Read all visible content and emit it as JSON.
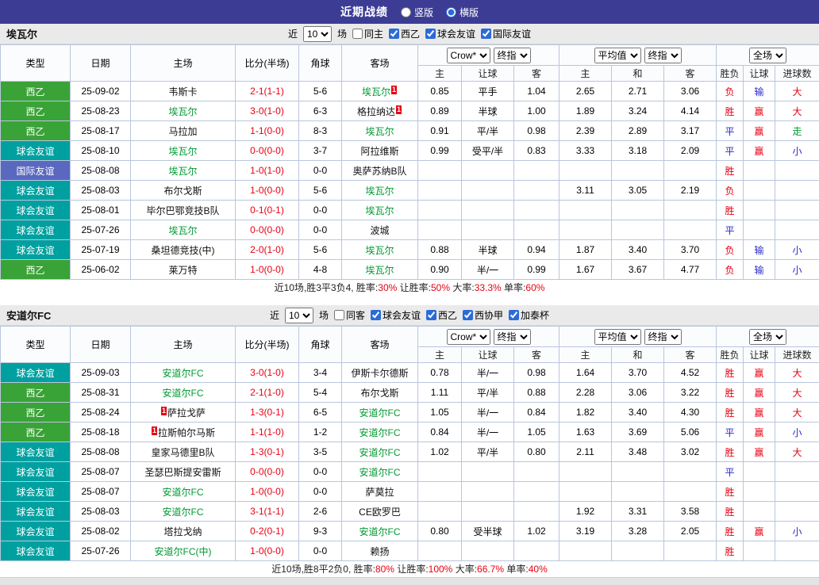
{
  "header": {
    "title": "近期战绩",
    "options": [
      {
        "label": "竖版",
        "selected": false
      },
      {
        "label": "横版",
        "selected": true
      }
    ]
  },
  "table_headers": {
    "main": [
      "类型",
      "日期",
      "主场",
      "比分(半场)",
      "角球",
      "客场"
    ],
    "ah_dropdowns": [
      "Crow*",
      "终指"
    ],
    "eu_dropdowns": [
      "平均值",
      "终指"
    ],
    "scope_dropdown": "全场",
    "sub": [
      "主",
      "让球",
      "客",
      "主",
      "和",
      "客",
      "胜负",
      "让球",
      "进球数"
    ]
  },
  "colors": {
    "red": "#e60012",
    "blue": "#2929cc",
    "green": "#009933",
    "black": "#222222",
    "type_green": "#3aa337",
    "type_teal": "#00a0a0",
    "type_blue": "#5a68c0"
  },
  "sections": [
    {
      "team": "埃瓦尔",
      "filter": {
        "near": "近",
        "count": "10",
        "games": "场",
        "checkboxes": [
          {
            "label": "同主",
            "checked": false
          },
          {
            "label": "西乙",
            "checked": true
          },
          {
            "label": "球会友谊",
            "checked": true
          },
          {
            "label": "国际友谊",
            "checked": true
          }
        ]
      },
      "rows": [
        {
          "type": "西乙",
          "type_color": "type_green",
          "date": "25-09-02",
          "home": "韦斯卡",
          "home_hl": false,
          "home_card": "",
          "score": "2-1(1-1)",
          "corner": "5-6",
          "away": "埃瓦尔",
          "away_hl": true,
          "away_card": "1",
          "ah": [
            "0.85",
            "平手",
            "1.04"
          ],
          "eu": [
            "2.65",
            "2.71",
            "3.06"
          ],
          "res": [
            {
              "t": "负",
              "c": "red"
            },
            {
              "t": "输",
              "c": "blue"
            },
            {
              "t": "大",
              "c": "red"
            }
          ]
        },
        {
          "type": "西乙",
          "type_color": "type_green",
          "date": "25-08-23",
          "home": "埃瓦尔",
          "home_hl": true,
          "home_card": "",
          "score": "3-0(1-0)",
          "corner": "6-3",
          "away": "格拉纳达",
          "away_hl": false,
          "away_card": "1",
          "ah": [
            "0.89",
            "半球",
            "1.00"
          ],
          "eu": [
            "1.89",
            "3.24",
            "4.14"
          ],
          "res": [
            {
              "t": "胜",
              "c": "red"
            },
            {
              "t": "赢",
              "c": "red"
            },
            {
              "t": "大",
              "c": "red"
            }
          ]
        },
        {
          "type": "西乙",
          "type_color": "type_green",
          "date": "25-08-17",
          "home": "马拉加",
          "home_hl": false,
          "home_card": "",
          "score": "1-1(0-0)",
          "corner": "8-3",
          "away": "埃瓦尔",
          "away_hl": true,
          "away_card": "",
          "ah": [
            "0.91",
            "平/半",
            "0.98"
          ],
          "eu": [
            "2.39",
            "2.89",
            "3.17"
          ],
          "res": [
            {
              "t": "平",
              "c": "blue"
            },
            {
              "t": "赢",
              "c": "red"
            },
            {
              "t": "走",
              "c": "green"
            }
          ]
        },
        {
          "type": "球会友谊",
          "type_color": "type_teal",
          "date": "25-08-10",
          "home": "埃瓦尔",
          "home_hl": true,
          "home_card": "",
          "score": "0-0(0-0)",
          "corner": "3-7",
          "away": "阿拉维斯",
          "away_hl": false,
          "away_card": "",
          "ah": [
            "0.99",
            "受平/半",
            "0.83"
          ],
          "eu": [
            "3.33",
            "3.18",
            "2.09"
          ],
          "res": [
            {
              "t": "平",
              "c": "blue"
            },
            {
              "t": "赢",
              "c": "red"
            },
            {
              "t": "小",
              "c": "blue"
            }
          ]
        },
        {
          "type": "国际友谊",
          "type_color": "type_blue",
          "date": "25-08-08",
          "home": "埃瓦尔",
          "home_hl": true,
          "home_card": "",
          "score": "1-0(1-0)",
          "corner": "0-0",
          "away": "奥萨苏纳B队",
          "away_hl": false,
          "away_card": "",
          "ah": [
            "",
            "",
            ""
          ],
          "eu": [
            "",
            "",
            ""
          ],
          "res": [
            {
              "t": "胜",
              "c": "red"
            },
            {
              "t": "",
              "c": "black"
            },
            {
              "t": "",
              "c": "black"
            }
          ]
        },
        {
          "type": "球会友谊",
          "type_color": "type_teal",
          "date": "25-08-03",
          "home": "布尔戈斯",
          "home_hl": false,
          "home_card": "",
          "score": "1-0(0-0)",
          "corner": "5-6",
          "away": "埃瓦尔",
          "away_hl": true,
          "away_card": "",
          "ah": [
            "",
            "",
            ""
          ],
          "eu": [
            "3.11",
            "3.05",
            "2.19"
          ],
          "res": [
            {
              "t": "负",
              "c": "red"
            },
            {
              "t": "",
              "c": "black"
            },
            {
              "t": "",
              "c": "black"
            }
          ]
        },
        {
          "type": "球会友谊",
          "type_color": "type_teal",
          "date": "25-08-01",
          "home": "毕尔巴鄂竞技B队",
          "home_hl": false,
          "home_card": "",
          "score": "0-1(0-1)",
          "corner": "0-0",
          "away": "埃瓦尔",
          "away_hl": true,
          "away_card": "",
          "ah": [
            "",
            "",
            ""
          ],
          "eu": [
            "",
            "",
            ""
          ],
          "res": [
            {
              "t": "胜",
              "c": "red"
            },
            {
              "t": "",
              "c": "black"
            },
            {
              "t": "",
              "c": "black"
            }
          ]
        },
        {
          "type": "球会友谊",
          "type_color": "type_teal",
          "date": "25-07-26",
          "home": "埃瓦尔",
          "home_hl": true,
          "home_card": "",
          "score": "0-0(0-0)",
          "corner": "0-0",
          "away": "波城",
          "away_hl": false,
          "away_card": "",
          "ah": [
            "",
            "",
            ""
          ],
          "eu": [
            "",
            "",
            ""
          ],
          "res": [
            {
              "t": "平",
              "c": "blue"
            },
            {
              "t": "",
              "c": "black"
            },
            {
              "t": "",
              "c": "black"
            }
          ]
        },
        {
          "type": "球会友谊",
          "type_color": "type_teal",
          "date": "25-07-19",
          "home": "桑坦德竞技(中)",
          "home_hl": false,
          "home_card": "",
          "score": "2-0(1-0)",
          "corner": "5-6",
          "away": "埃瓦尔",
          "away_hl": true,
          "away_card": "",
          "ah": [
            "0.88",
            "半球",
            "0.94"
          ],
          "eu": [
            "1.87",
            "3.40",
            "3.70"
          ],
          "res": [
            {
              "t": "负",
              "c": "red"
            },
            {
              "t": "输",
              "c": "blue"
            },
            {
              "t": "小",
              "c": "blue"
            }
          ]
        },
        {
          "type": "西乙",
          "type_color": "type_green",
          "date": "25-06-02",
          "home": "莱万特",
          "home_hl": false,
          "home_card": "",
          "score": "1-0(0-0)",
          "corner": "4-8",
          "away": "埃瓦尔",
          "away_hl": true,
          "away_card": "",
          "ah": [
            "0.90",
            "半/一",
            "0.99"
          ],
          "eu": [
            "1.67",
            "3.67",
            "4.77"
          ],
          "res": [
            {
              "t": "负",
              "c": "red"
            },
            {
              "t": "输",
              "c": "blue"
            },
            {
              "t": "小",
              "c": "blue"
            }
          ]
        }
      ],
      "summary": [
        {
          "t": "近10场,胜3平3负4, 胜率:",
          "c": "black"
        },
        {
          "t": "30%",
          "c": "red"
        },
        {
          "t": " 让胜率:",
          "c": "black"
        },
        {
          "t": "50%",
          "c": "red"
        },
        {
          "t": " 大率:",
          "c": "black"
        },
        {
          "t": "33.3%",
          "c": "red"
        },
        {
          "t": " 单率:",
          "c": "black"
        },
        {
          "t": "60%",
          "c": "red"
        }
      ]
    },
    {
      "team": "安道尔FC",
      "filter": {
        "near": "近",
        "count": "10",
        "games": "场",
        "checkboxes": [
          {
            "label": "同客",
            "checked": false
          },
          {
            "label": "球会友谊",
            "checked": true
          },
          {
            "label": "西乙",
            "checked": true
          },
          {
            "label": "西协甲",
            "checked": true
          },
          {
            "label": "加泰杯",
            "checked": true
          }
        ]
      },
      "rows": [
        {
          "type": "球会友谊",
          "type_color": "type_teal",
          "date": "25-09-03",
          "home": "安道尔FC",
          "home_hl": true,
          "home_card": "",
          "score": "3-0(1-0)",
          "corner": "3-4",
          "away": "伊斯卡尔德斯",
          "away_hl": false,
          "away_card": "",
          "ah": [
            "0.78",
            "半/一",
            "0.98"
          ],
          "eu": [
            "1.64",
            "3.70",
            "4.52"
          ],
          "res": [
            {
              "t": "胜",
              "c": "red"
            },
            {
              "t": "赢",
              "c": "red"
            },
            {
              "t": "大",
              "c": "red"
            }
          ]
        },
        {
          "type": "西乙",
          "type_color": "type_green",
          "date": "25-08-31",
          "home": "安道尔FC",
          "home_hl": true,
          "home_card": "",
          "score": "2-1(1-0)",
          "corner": "5-4",
          "away": "布尔戈斯",
          "away_hl": false,
          "away_card": "",
          "ah": [
            "1.11",
            "平/半",
            "0.88"
          ],
          "eu": [
            "2.28",
            "3.06",
            "3.22"
          ],
          "res": [
            {
              "t": "胜",
              "c": "red"
            },
            {
              "t": "赢",
              "c": "red"
            },
            {
              "t": "大",
              "c": "red"
            }
          ]
        },
        {
          "type": "西乙",
          "type_color": "type_green",
          "date": "25-08-24",
          "home": "萨拉戈萨",
          "home_hl": false,
          "home_card": "1",
          "score": "1-3(0-1)",
          "corner": "6-5",
          "away": "安道尔FC",
          "away_hl": true,
          "away_card": "",
          "ah": [
            "1.05",
            "半/一",
            "0.84"
          ],
          "eu": [
            "1.82",
            "3.40",
            "4.30"
          ],
          "res": [
            {
              "t": "胜",
              "c": "red"
            },
            {
              "t": "赢",
              "c": "red"
            },
            {
              "t": "大",
              "c": "red"
            }
          ]
        },
        {
          "type": "西乙",
          "type_color": "type_green",
          "date": "25-08-18",
          "home": "拉斯帕尔马斯",
          "home_hl": false,
          "home_card": "1",
          "score": "1-1(1-0)",
          "corner": "1-2",
          "away": "安道尔FC",
          "away_hl": true,
          "away_card": "",
          "ah": [
            "0.84",
            "半/一",
            "1.05"
          ],
          "eu": [
            "1.63",
            "3.69",
            "5.06"
          ],
          "res": [
            {
              "t": "平",
              "c": "blue"
            },
            {
              "t": "赢",
              "c": "red"
            },
            {
              "t": "小",
              "c": "blue"
            }
          ]
        },
        {
          "type": "球会友谊",
          "type_color": "type_teal",
          "date": "25-08-08",
          "home": "皇家马德里B队",
          "home_hl": false,
          "home_card": "",
          "score": "1-3(0-1)",
          "corner": "3-5",
          "away": "安道尔FC",
          "away_hl": true,
          "away_card": "",
          "ah": [
            "1.02",
            "平/半",
            "0.80"
          ],
          "eu": [
            "2.11",
            "3.48",
            "3.02"
          ],
          "res": [
            {
              "t": "胜",
              "c": "red"
            },
            {
              "t": "赢",
              "c": "red"
            },
            {
              "t": "大",
              "c": "red"
            }
          ]
        },
        {
          "type": "球会友谊",
          "type_color": "type_teal",
          "date": "25-08-07",
          "home": "圣瑟巴斯提安雷斯",
          "home_hl": false,
          "home_card": "",
          "score": "0-0(0-0)",
          "corner": "0-0",
          "away": "安道尔FC",
          "away_hl": true,
          "away_card": "",
          "ah": [
            "",
            "",
            ""
          ],
          "eu": [
            "",
            "",
            ""
          ],
          "res": [
            {
              "t": "平",
              "c": "blue"
            },
            {
              "t": "",
              "c": "black"
            },
            {
              "t": "",
              "c": "black"
            }
          ]
        },
        {
          "type": "球会友谊",
          "type_color": "type_teal",
          "date": "25-08-07",
          "home": "安道尔FC",
          "home_hl": true,
          "home_card": "",
          "score": "1-0(0-0)",
          "corner": "0-0",
          "away": "萨莫拉",
          "away_hl": false,
          "away_card": "",
          "ah": [
            "",
            "",
            ""
          ],
          "eu": [
            "",
            "",
            ""
          ],
          "res": [
            {
              "t": "胜",
              "c": "red"
            },
            {
              "t": "",
              "c": "black"
            },
            {
              "t": "",
              "c": "black"
            }
          ]
        },
        {
          "type": "球会友谊",
          "type_color": "type_teal",
          "date": "25-08-03",
          "home": "安道尔FC",
          "home_hl": true,
          "home_card": "",
          "score": "3-1(1-1)",
          "corner": "2-6",
          "away": "CE欧罗巴",
          "away_hl": false,
          "away_card": "",
          "ah": [
            "",
            "",
            ""
          ],
          "eu": [
            "1.92",
            "3.31",
            "3.58"
          ],
          "res": [
            {
              "t": "胜",
              "c": "red"
            },
            {
              "t": "",
              "c": "black"
            },
            {
              "t": "",
              "c": "black"
            }
          ]
        },
        {
          "type": "球会友谊",
          "type_color": "type_teal",
          "date": "25-08-02",
          "home": "塔拉戈纳",
          "home_hl": false,
          "home_card": "",
          "score": "0-2(0-1)",
          "corner": "9-3",
          "away": "安道尔FC",
          "away_hl": true,
          "away_card": "",
          "ah": [
            "0.80",
            "受半球",
            "1.02"
          ],
          "eu": [
            "3.19",
            "3.28",
            "2.05"
          ],
          "res": [
            {
              "t": "胜",
              "c": "red"
            },
            {
              "t": "赢",
              "c": "red"
            },
            {
              "t": "小",
              "c": "blue"
            }
          ]
        },
        {
          "type": "球会友谊",
          "type_color": "type_teal",
          "date": "25-07-26",
          "home": "安道尔FC(中)",
          "home_hl": true,
          "home_card": "",
          "score": "1-0(0-0)",
          "corner": "0-0",
          "away": "赖扬",
          "away_hl": false,
          "away_card": "",
          "ah": [
            "",
            "",
            ""
          ],
          "eu": [
            "",
            "",
            ""
          ],
          "res": [
            {
              "t": "胜",
              "c": "red"
            },
            {
              "t": "",
              "c": "black"
            },
            {
              "t": "",
              "c": "black"
            }
          ]
        }
      ],
      "summary": [
        {
          "t": "近10场,胜8平2负0, 胜率:",
          "c": "black"
        },
        {
          "t": "80%",
          "c": "red"
        },
        {
          "t": " 让胜率:",
          "c": "black"
        },
        {
          "t": "100%",
          "c": "red"
        },
        {
          "t": " 大率:",
          "c": "black"
        },
        {
          "t": "66.7%",
          "c": "red"
        },
        {
          "t": " 单率:",
          "c": "black"
        },
        {
          "t": "40%",
          "c": "red"
        }
      ]
    }
  ]
}
